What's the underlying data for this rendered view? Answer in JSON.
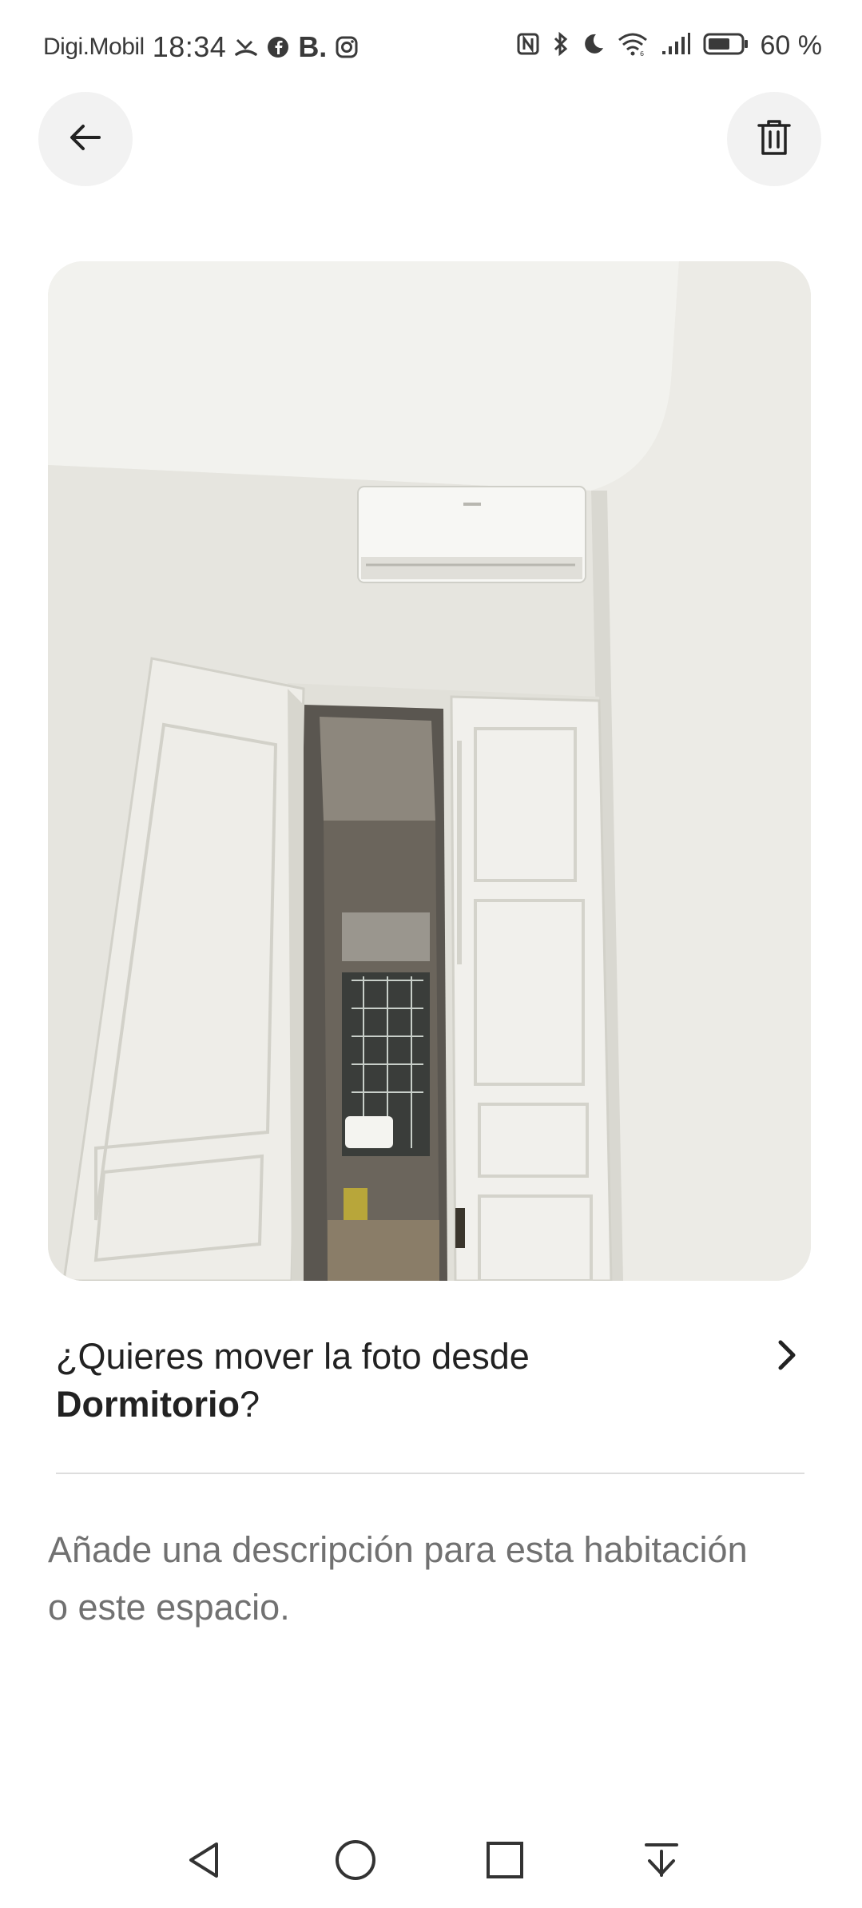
{
  "status_bar": {
    "carrier": "Digi.Mobil",
    "time": "18:34",
    "notification_b": "B.",
    "battery_percent": "60 %",
    "left_icons": [
      "missed-call-icon",
      "facebook-icon",
      "b-app-icon",
      "instagram-icon"
    ],
    "right_icons": [
      "nfc-icon",
      "bluetooth-icon",
      "moon-icon",
      "wifi-icon",
      "signal-icon",
      "battery-icon"
    ]
  },
  "toolbar": {
    "back_icon": "arrow-left-icon",
    "delete_icon": "trash-icon"
  },
  "photo": {
    "subject": "room-photo"
  },
  "move_photo": {
    "prefix": "¿Quieres mover la foto desde",
    "room": "Dormitorio",
    "suffix": "?",
    "icon": "chevron-right-icon"
  },
  "description": {
    "placeholder": "Añade una descripción para esta habitación o este espacio."
  },
  "nav_bar": {
    "icons": [
      "back-triangle-icon",
      "home-circle-icon",
      "recents-square-icon",
      "notification-pull-icon"
    ]
  },
  "colors": {
    "text_primary": "#222222",
    "text_secondary": "#717171",
    "button_bg": "#f2f2f2",
    "divider": "#dddddd"
  }
}
